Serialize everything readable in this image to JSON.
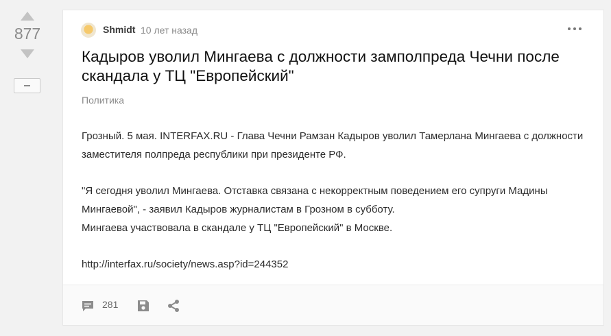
{
  "vote": {
    "score": "877"
  },
  "post": {
    "author": "Shmidt",
    "time": "10 лет назад",
    "title": "Кадыров уволил Мингаева с должности замполпреда Чечни после скандала у ТЦ \"Европейский\"",
    "tag": "Политика",
    "paragraphs": [
      "Грозный. 5 мая. INTERFAX.RU - Глава Чечни Рамзан Кадыров уволил Тамерлана Мингаева с должности заместителя полпреда республики при президенте РФ.",
      "\"Я сегодня уволил Мингаева. Отставка связана с некорректным поведением его супруги Мадины Мингаевой\", - заявил Кадыров журналистам в Грозном в субботу.",
      "Мингаева участвовала в скандале у ТЦ \"Европейский\" в Москве."
    ],
    "link": "http://interfax.ru/society/news.asp?id=244352"
  },
  "footer": {
    "comments_count": "281"
  },
  "icons": {
    "upvote": "arrow-up-icon",
    "downvote": "arrow-down-icon",
    "collapse": "minus-icon",
    "more": "more-dots-icon",
    "comments": "comment-icon",
    "save": "save-icon",
    "share": "share-icon"
  },
  "colors": {
    "vote_gray": "#c3c3c3",
    "text": "#111111",
    "muted": "#8a8a8a",
    "icon": "#8c8c8c"
  }
}
